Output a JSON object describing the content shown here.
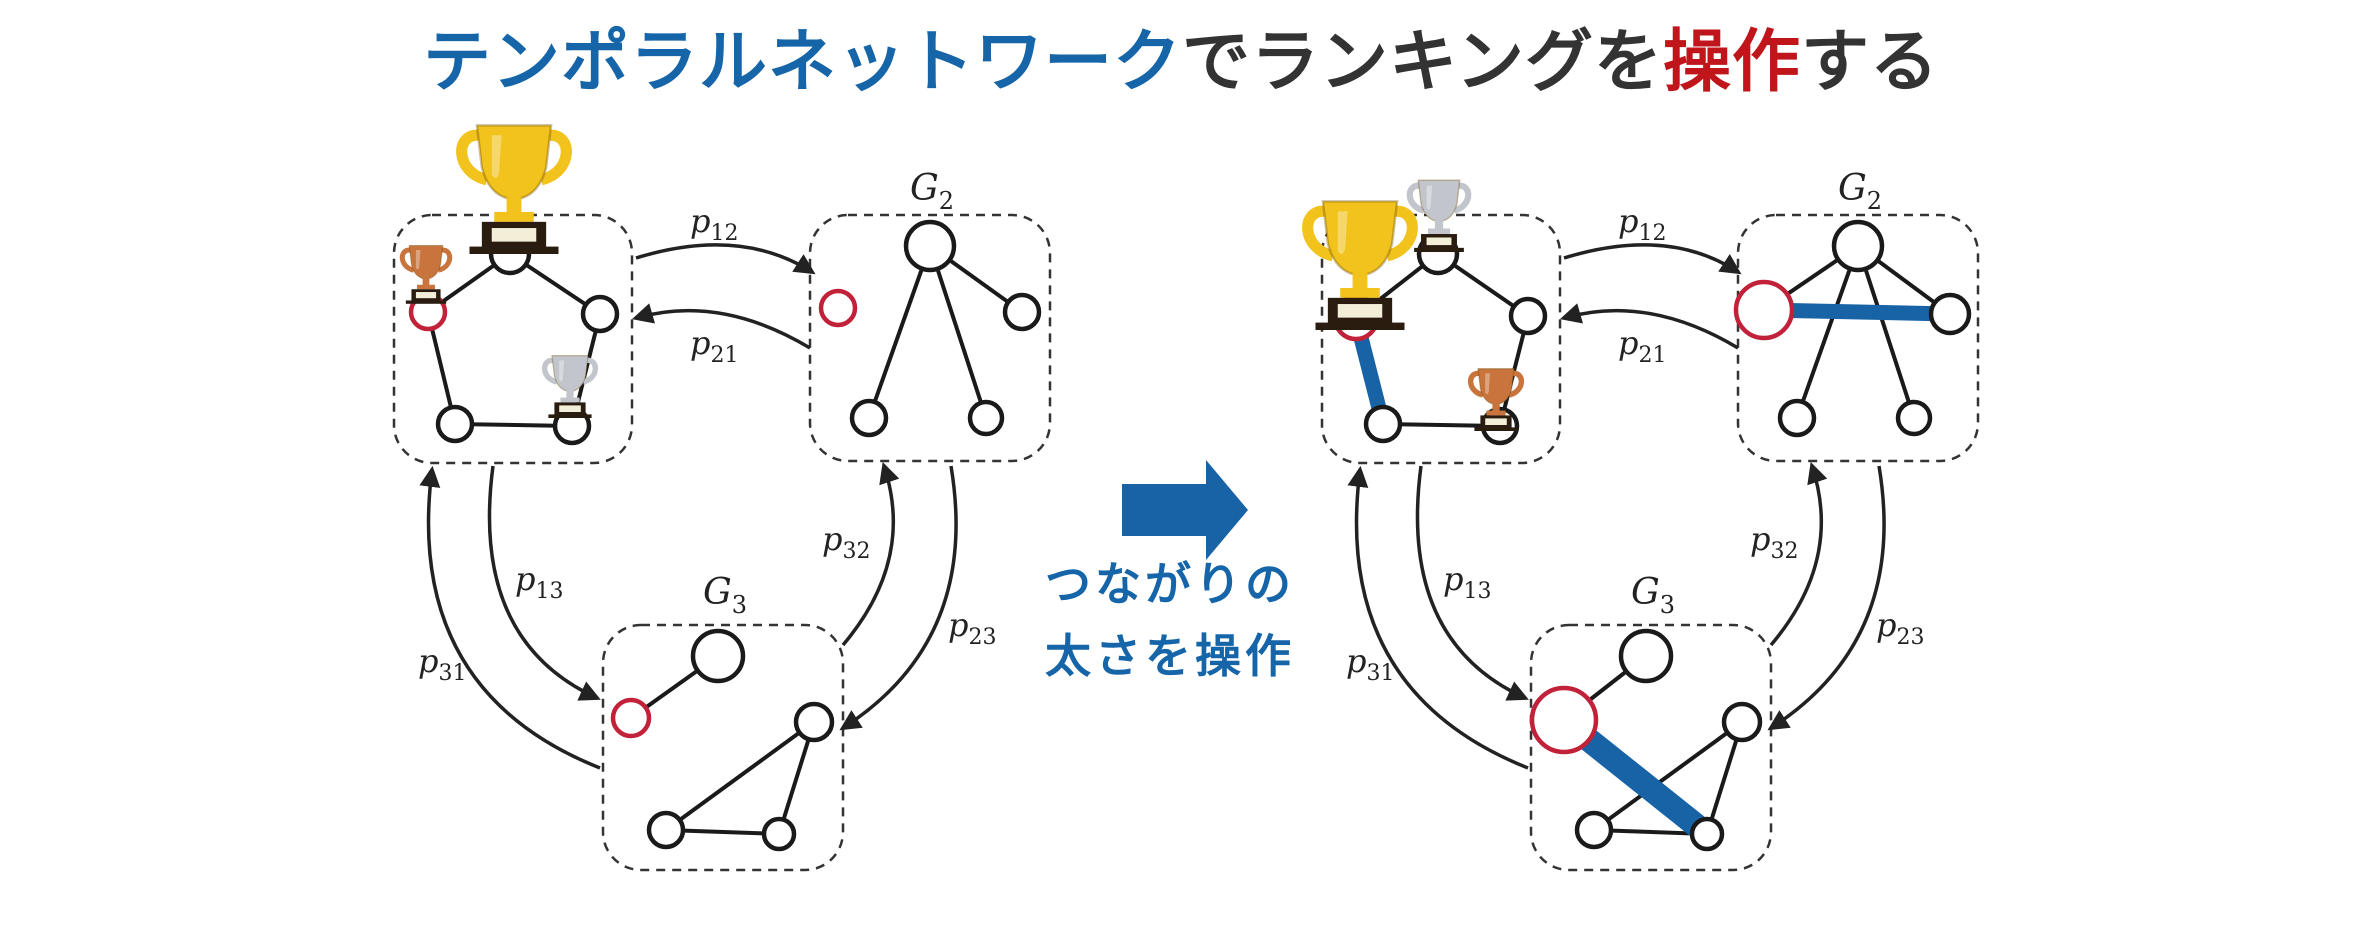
{
  "title": {
    "part1": "テンポラルネットワーク",
    "part2": "でランキングを",
    "part3": "操作",
    "part4": "する"
  },
  "colors": {
    "title_blue": "#1565a8",
    "title_dark": "#333333",
    "title_red": "#c0161b",
    "accent_blue": "#1763a6",
    "highlight_red": "#c2213a",
    "node_stroke": "#1a1a1a"
  },
  "arrow": {
    "icon": "right-arrow-icon"
  },
  "caption": {
    "line1": "つながりの",
    "line2": "太さを操作"
  },
  "graphs": {
    "g2_label": {
      "main": "G",
      "sub": "2"
    },
    "g3_label": {
      "main": "G",
      "sub": "3"
    }
  },
  "edges": {
    "p12": {
      "main": "p",
      "sub": "12"
    },
    "p21": {
      "main": "p",
      "sub": "21"
    },
    "p13": {
      "main": "p",
      "sub": "13"
    },
    "p31": {
      "main": "p",
      "sub": "31"
    },
    "p23": {
      "main": "p",
      "sub": "23"
    },
    "p32": {
      "main": "p",
      "sub": "32"
    }
  },
  "icons": [
    "gold-trophy-icon",
    "silver-trophy-icon",
    "bronze-trophy-icon"
  ]
}
